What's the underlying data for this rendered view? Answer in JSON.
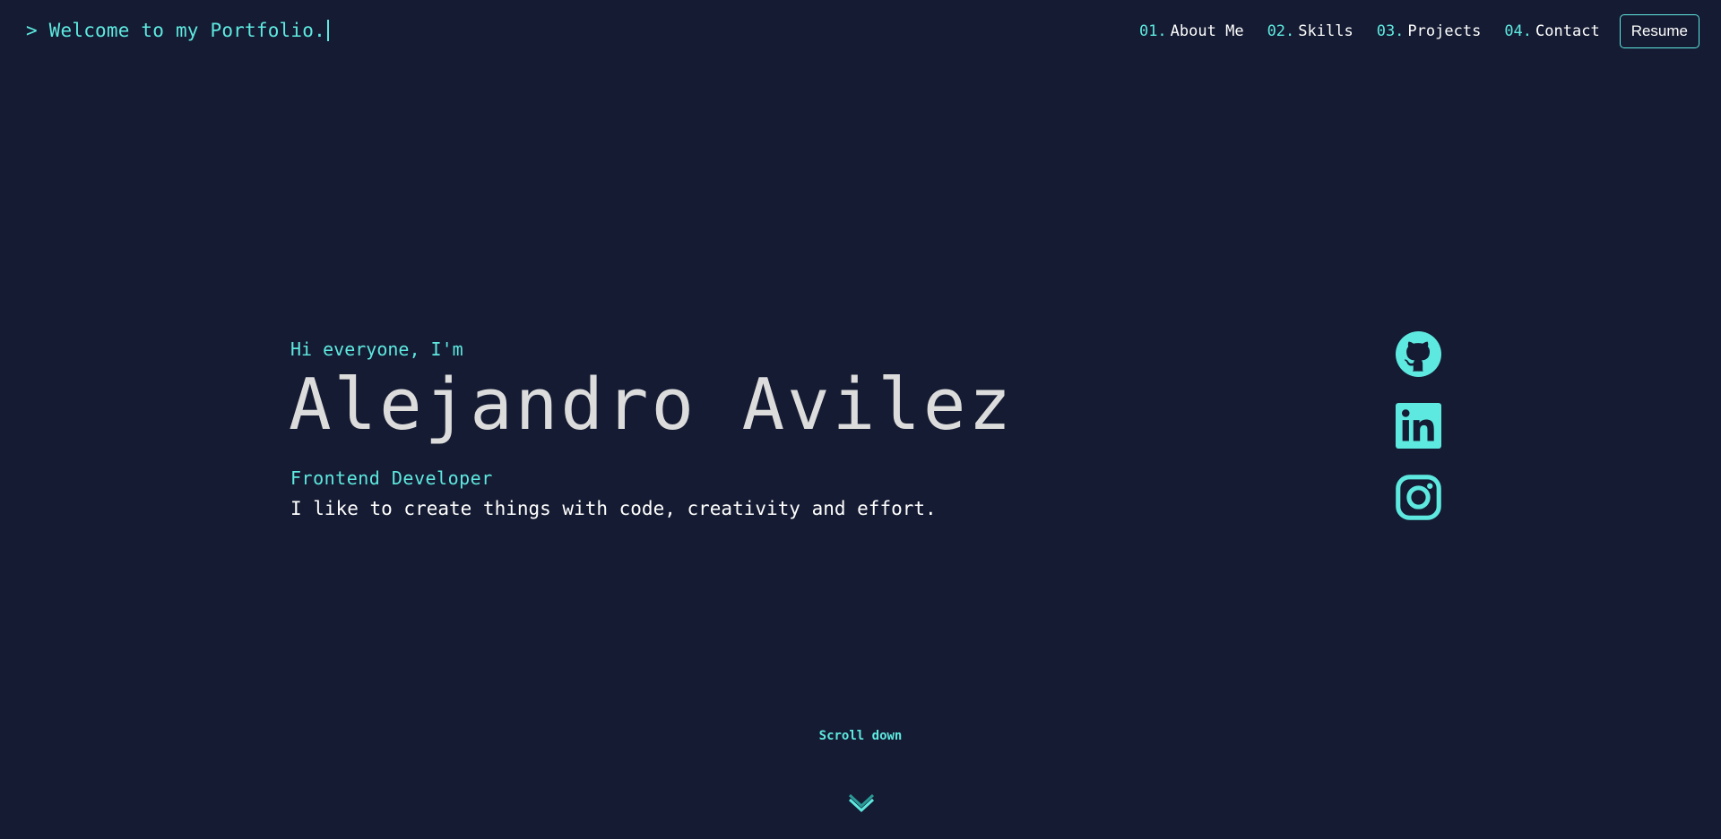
{
  "header": {
    "brand_text": "> Welcome to my Portfolio.",
    "nav": [
      {
        "num": "01.",
        "label": "About Me"
      },
      {
        "num": "02.",
        "label": "Skills"
      },
      {
        "num": "03.",
        "label": "Projects"
      },
      {
        "num": "04.",
        "label": "Contact"
      }
    ],
    "resume_label": "Resume"
  },
  "hero": {
    "greeting": "Hi everyone, I'm",
    "name": "Alejandro Avilez",
    "role": "Frontend Developer",
    "tagline": "I like to create things with code, creativity and effort."
  },
  "social": {
    "icons": [
      "github-icon",
      "linkedin-icon",
      "instagram-icon"
    ]
  },
  "scroll": {
    "label": "Scroll down",
    "icon": "chevron-down-icon"
  },
  "colors": {
    "background": "#151b32",
    "accent": "#5ee9e0",
    "text": "#ffffff",
    "heading": "#dcdcdc"
  }
}
